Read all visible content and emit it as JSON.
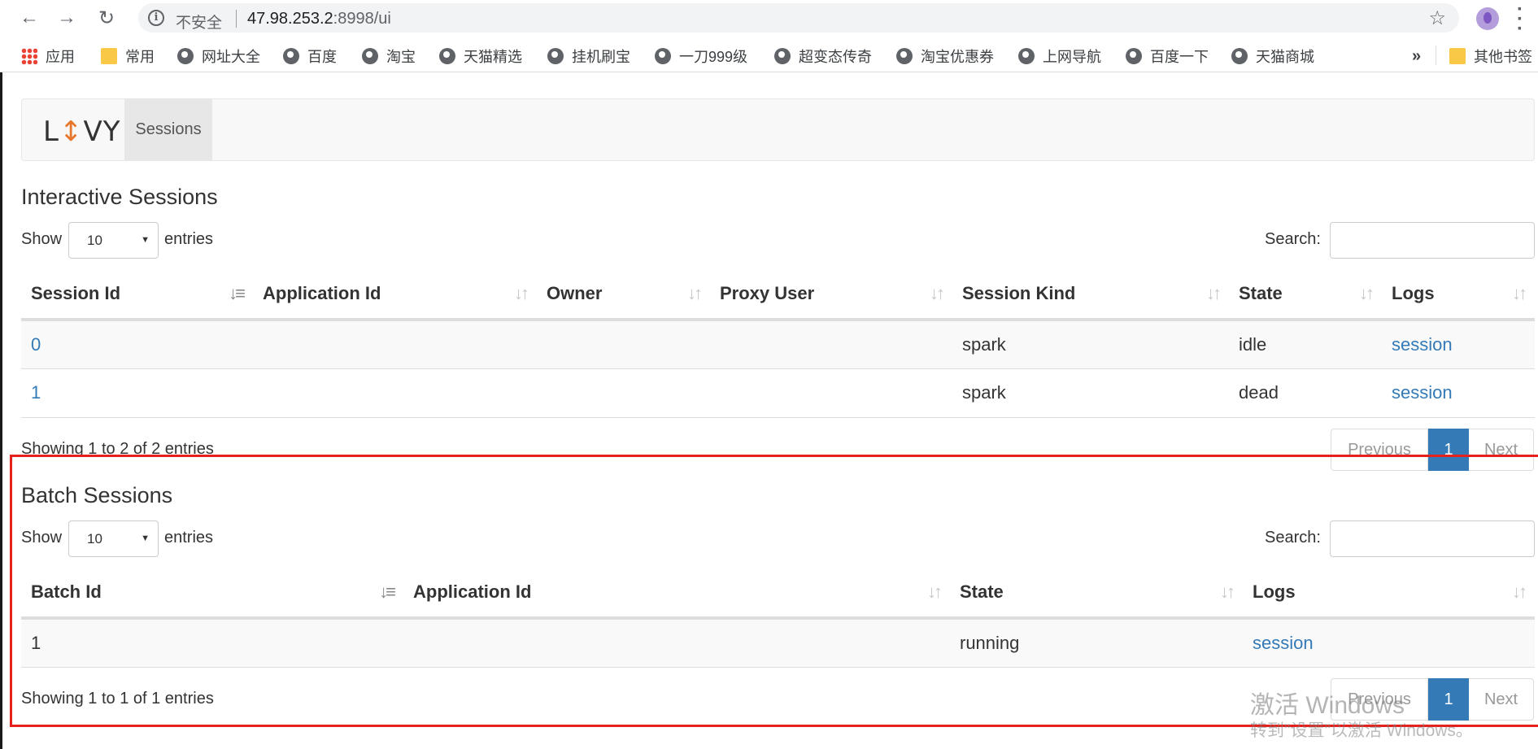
{
  "browser": {
    "insecure_label": "不安全",
    "url_host": "47.98.253.2",
    "url_rest": ":8998/ui",
    "bookmarks": [
      {
        "label": "应用",
        "icon": "apps-icon"
      },
      {
        "label": "常用",
        "icon": "folder-icon"
      },
      {
        "label": "网址大全",
        "icon": "globe-icon"
      },
      {
        "label": "百度",
        "icon": "globe-icon"
      },
      {
        "label": "淘宝",
        "icon": "globe-icon"
      },
      {
        "label": "天猫精选",
        "icon": "globe-icon"
      },
      {
        "label": "挂机刷宝",
        "icon": "globe-icon"
      },
      {
        "label": "一刀999级",
        "icon": "globe-icon"
      },
      {
        "label": "超变态传奇",
        "icon": "globe-icon"
      },
      {
        "label": "淘宝优惠券",
        "icon": "globe-icon"
      },
      {
        "label": "上网导航",
        "icon": "globe-icon"
      },
      {
        "label": "百度一下",
        "icon": "globe-icon"
      },
      {
        "label": "天猫商城",
        "icon": "globe-icon"
      }
    ],
    "more_bookmarks": "»",
    "other_bookmarks": "其他书签"
  },
  "navbar": {
    "logo_left": "L",
    "logo_accent": "↕",
    "logo_right": "VY",
    "sessions_link": "Sessions"
  },
  "interactive": {
    "title": "Interactive Sessions",
    "show_label": "Show",
    "page_length": "10",
    "entries_label": "entries",
    "search_label": "Search:",
    "columns": [
      "Session Id",
      "Application Id",
      "Owner",
      "Proxy User",
      "Session Kind",
      "State",
      "Logs"
    ],
    "rows": [
      {
        "id": "0",
        "app_id": "",
        "owner": "",
        "proxy_user": "",
        "kind": "spark",
        "state": "idle",
        "logs": "session"
      },
      {
        "id": "1",
        "app_id": "",
        "owner": "",
        "proxy_user": "",
        "kind": "spark",
        "state": "dead",
        "logs": "session"
      }
    ],
    "info": "Showing 1 to 2 of 2 entries",
    "pager": {
      "previous": "Previous",
      "current": "1",
      "next": "Next"
    }
  },
  "batch": {
    "title": "Batch Sessions",
    "show_label": "Show",
    "page_length": "10",
    "entries_label": "entries",
    "search_label": "Search:",
    "columns": [
      "Batch Id",
      "Application Id",
      "State",
      "Logs"
    ],
    "rows": [
      {
        "id": "1",
        "app_id": "",
        "state": "running",
        "logs": "session"
      }
    ],
    "info": "Showing 1 to 1 of 1 entries",
    "pager": {
      "previous": "Previous",
      "current": "1",
      "next": "Next"
    }
  },
  "watermark": {
    "line1": "激活 Windows",
    "line2": "转到\"设置\"以激活 Windows。"
  },
  "colors": {
    "link": "#337ab7",
    "accent": "#e8772e",
    "highlight_box": "#e5211d"
  }
}
